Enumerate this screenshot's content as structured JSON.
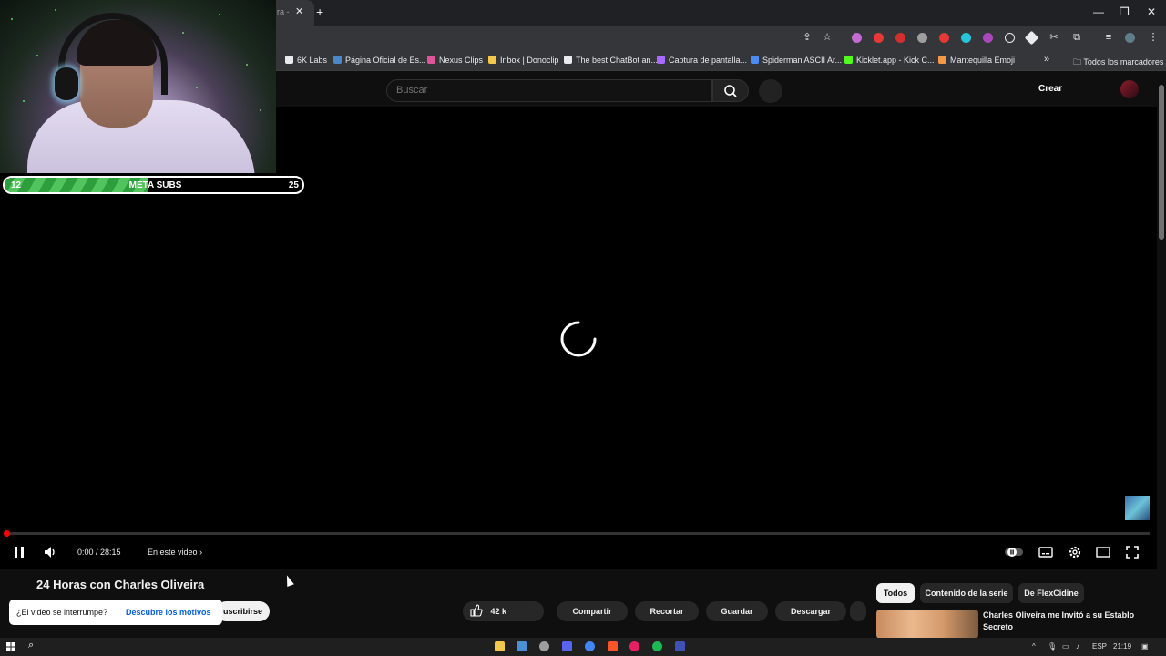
{
  "browser": {
    "tab_title": "ra -",
    "bookmarks": [
      {
        "label": "6K Labs",
        "color": "#e8eaed"
      },
      {
        "label": "Página Oficial de Es...",
        "color": "#4f86c6"
      },
      {
        "label": "Nexus Clips",
        "color": "#e0559a"
      },
      {
        "label": "Inbox | Donoclip",
        "color": "#f2c94c"
      },
      {
        "label": "The best ChatBot an...",
        "color": "#e8eaed"
      },
      {
        "label": "Captura de pantalla...",
        "color": "#a86bff"
      },
      {
        "label": "Spiderman ASCII Ar...",
        "color": "#4b8bf5"
      },
      {
        "label": "Kicklet.app - Kick C...",
        "color": "#53fc18"
      },
      {
        "label": "Mantequilla Emoji",
        "color": "#f2994a"
      }
    ],
    "bookmarks_folder": "Todos los marcadores"
  },
  "youtube": {
    "search_placeholder": "Buscar",
    "create_label": "Crear",
    "player": {
      "time": "0:00 / 28:15",
      "chapter_label": "En este video",
      "progress": 0
    },
    "video_title": "24 Horas con Charles Oliveira",
    "popup": {
      "question": "¿El video se interrumpe?",
      "link": "Descubre los motivos"
    },
    "subscribe_label": "uscribirse",
    "actions": {
      "likes": "42 k",
      "share": "Compartir",
      "clip": "Recortar",
      "save": "Guardar",
      "download": "Descargar"
    },
    "chips": [
      "Todos",
      "Contenido de la serie",
      "De FlexCidine"
    ],
    "recommendation": {
      "title": "Charles Oliveira me Invitó a su Establo Secreto"
    }
  },
  "overlay": {
    "meta_current": "12",
    "meta_label": "META SUBS",
    "meta_goal": "25",
    "meta_progress": 0.48
  },
  "taskbar": {
    "lang": "ESP",
    "clock": "21:19"
  }
}
